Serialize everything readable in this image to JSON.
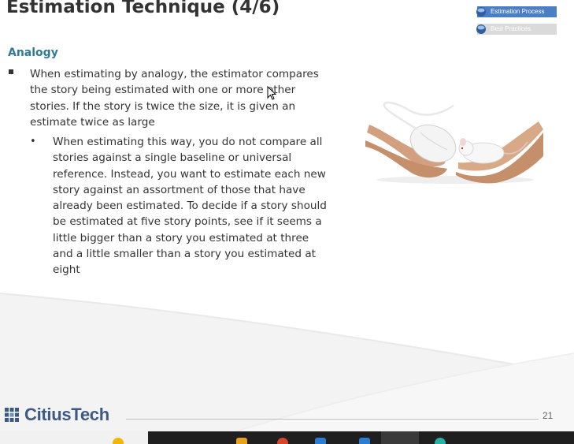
{
  "slide": {
    "title": "Estimation Technique (4/6)",
    "nav": [
      {
        "label": "Estimation Process",
        "active": true
      },
      {
        "label": "Best  Practices",
        "active": false
      }
    ],
    "section_heading": "Analogy",
    "bullet_main": "When estimating by analogy, the estimator compares the story being estimated with one or more other stories. If the story is twice the size, it is given an estimate twice as large",
    "bullet_sub": "When estimating this way, you do not compare all stories against a single baseline or universal reference. Instead, you want to estimate each new story against an assortment of those that have already been estimated. To decide if a story should be estimated at five story points, see if it seems a little bigger than a story you estimated at three and a little smaller than a story you estimated at eight",
    "bullet_sub_marker": "•",
    "image": "hands-holding-computer-mouse-and-real-mouse",
    "footer": {
      "logo_text": "CitiusTech",
      "page_number": "21"
    }
  },
  "taskbar": {
    "icons": [
      "chrome-icon",
      "outlook-icon",
      "file-explorer-icon",
      "teams-icon",
      "edge-icon"
    ]
  },
  "colors": {
    "title": "#333333",
    "section": "#2f7a97",
    "nav_active": "#4a7fc6",
    "nav_inactive": "#dadada",
    "logo": "#3d5a86"
  }
}
